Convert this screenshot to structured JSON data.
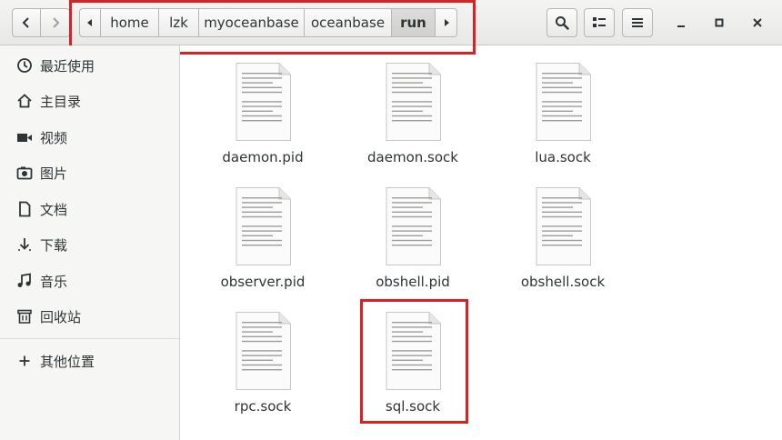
{
  "header": {
    "back_icon": "chevron-left-icon",
    "forward_icon": "chevron-right-icon",
    "path_left_icon": "triangle-left-icon",
    "path_right_icon": "triangle-right-icon",
    "breadcrumbs": [
      "home",
      "lzk",
      "myoceanbase",
      "oceanbase",
      "run"
    ],
    "active_crumb": "run",
    "search_icon": "search-icon",
    "view_icon": "list-view-icon",
    "menu_icon": "hamburger-menu-icon",
    "minimize_label": "–",
    "maximize_label": "□",
    "close_label": "✕"
  },
  "sidebar": {
    "items": [
      {
        "label": "最近使用",
        "icon": "clock-icon"
      },
      {
        "label": "主目录",
        "icon": "home-icon"
      },
      {
        "label": "视频",
        "icon": "video-icon"
      },
      {
        "label": "图片",
        "icon": "camera-icon"
      },
      {
        "label": "文档",
        "icon": "document-icon"
      },
      {
        "label": "下载",
        "icon": "download-icon"
      },
      {
        "label": "音乐",
        "icon": "music-icon"
      },
      {
        "label": "回收站",
        "icon": "trash-icon"
      },
      {
        "label": "其他位置",
        "icon": "plus-icon"
      }
    ]
  },
  "files": [
    {
      "name": "daemon.pid"
    },
    {
      "name": "daemon.sock"
    },
    {
      "name": "lua.sock"
    },
    {
      "name": "observer.pid"
    },
    {
      "name": "obshell.pid"
    },
    {
      "name": "obshell.sock"
    },
    {
      "name": "rpc.sock"
    },
    {
      "name": "sql.sock"
    }
  ],
  "colors": {
    "highlight": "#d62222",
    "sidebar_bg": "#f6f6f5",
    "header_bg": "#ececeb"
  }
}
